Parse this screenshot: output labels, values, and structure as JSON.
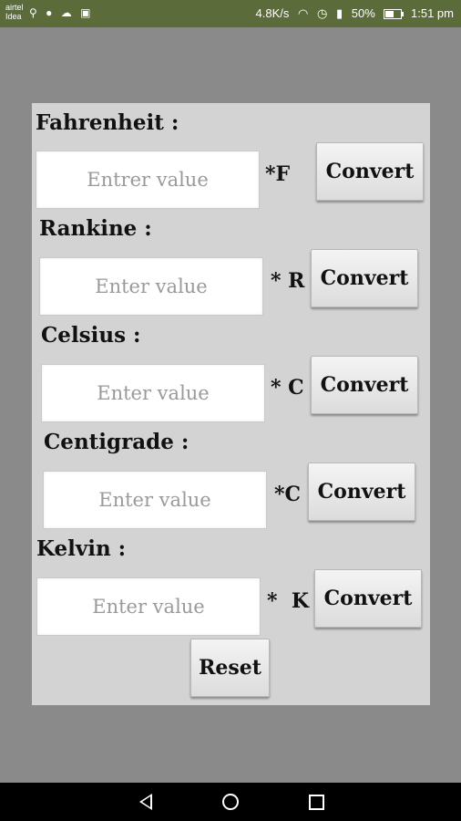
{
  "status_bar": {
    "carrier_line1": "airtel",
    "carrier_line2": "Idea",
    "speed": "4.8K/s",
    "battery_pct": "50%",
    "time": "1:51 pm"
  },
  "rows": [
    {
      "label": "Fahrenheit :",
      "placeholder": "Entrer value",
      "unit": "*F",
      "button": "Convert"
    },
    {
      "label": "Rankine :",
      "placeholder": "Enter value",
      "unit": "* R",
      "button": "Convert"
    },
    {
      "label": "Celsius :",
      "placeholder": "Enter value",
      "unit": "* C",
      "button": "Convert"
    },
    {
      "label": "Centigrade :",
      "placeholder": "Enter value",
      "unit": "*C",
      "button": "Convert"
    },
    {
      "label": "Kelvin :",
      "placeholder": "Enter value",
      "unit": "*  K",
      "button": "Convert"
    }
  ],
  "reset_label": "Reset",
  "colors": {
    "status_bar": "#5b6b3a",
    "background": "#8a8a8a",
    "panel": "#d3d3d3"
  }
}
